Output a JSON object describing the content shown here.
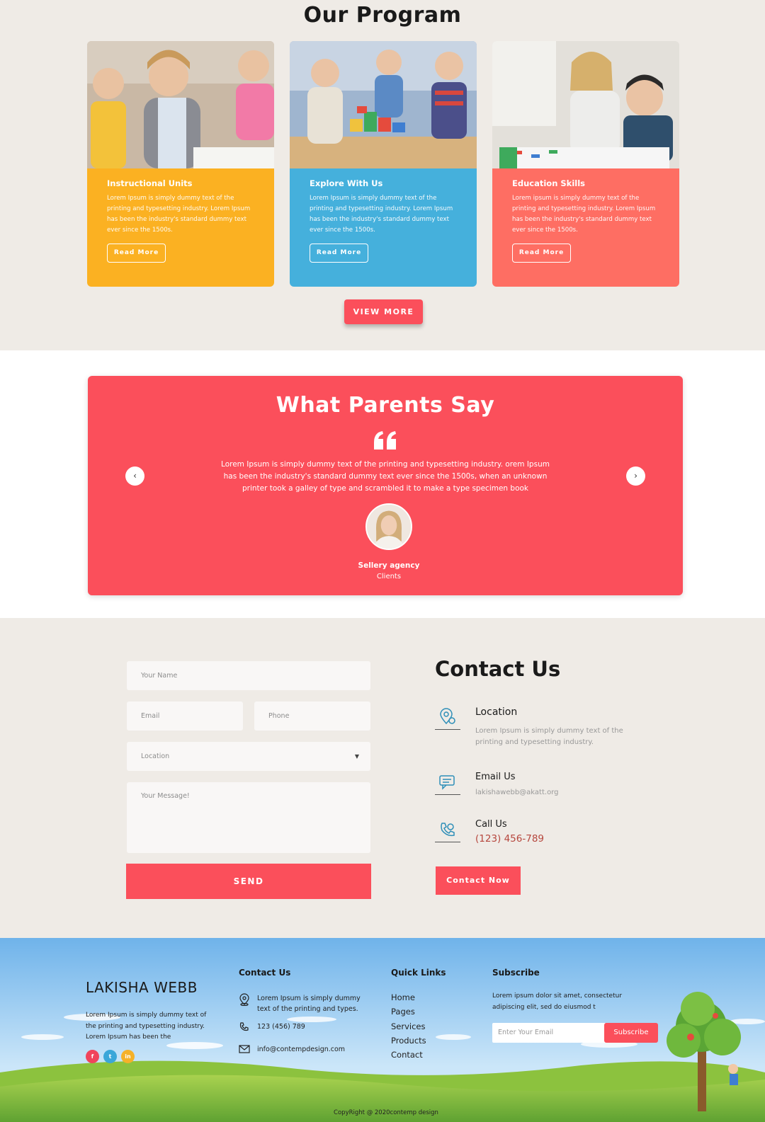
{
  "program": {
    "title": "Our Program",
    "cards": [
      {
        "title": "Instructional Units",
        "text": "Lorem Ipsum is simply dummy text of the printing and typesetting industry. Lorem Ipsum has been the industry's standard dummy text ever since the 1500s.",
        "button": "Read More",
        "color": "#fbb122"
      },
      {
        "title": "Explore With Us",
        "text": "Lorem Ipsum is simply dummy text of the printing and typesetting industry. Lorem Ipsum has been the industry's standard dummy text ever since the 1500s.",
        "button": "Read More",
        "color": "#45b0dc"
      },
      {
        "title": "Education Skills",
        "text": "Lorem ipsum is simply dummy text of the printing and typesetting industry. Lorem Ipsum has been the industry's standard dummy text ever since the 1500s.",
        "button": "Read More",
        "color": "#fe6e63"
      }
    ],
    "view_more": "VIEW MORE"
  },
  "testimonial": {
    "title": "What Parents Say",
    "quote": "Lorem Ipsum is simply dummy text of the printing and typesetting industry. orem Ipsum has been the industry's standard dummy text ever since the 1500s, when an unknown printer took a galley of type and scrambled it to make a type specimen book",
    "name": "Sellery agency",
    "role": "Clients",
    "prev_icon": "chevron-left-icon",
    "next_icon": "chevron-right-icon"
  },
  "form": {
    "name_placeholder": "Your Name",
    "email_placeholder": "Email",
    "phone_placeholder": "Phone",
    "location_placeholder": "Location",
    "message_placeholder": "Your Message!",
    "send": "SEND"
  },
  "contact": {
    "title": "Contact Us",
    "location_title": "Location",
    "location_text": "Lorem Ipsum is simply dummy text of the printing and typesetting industry.",
    "email_title": "Email Us",
    "email_text": "lakishawebb@akatt.org",
    "call_title": "Call Us",
    "call_text": "(123) 456-789",
    "button": "Contact Now"
  },
  "footer": {
    "brand": "LAKISHA WEBB",
    "about": "Lorem Ipsum is simply dummy text of the printing and typesetting industry. Lorem Ipsum has been the",
    "contact_title": "Contact Us",
    "contact_address": "Lorem Ipsum is simply dummy text of the printing and types.",
    "contact_phone": "123 (456) 789",
    "contact_email": "info@contempdesign.com",
    "links_title": "Quick Links",
    "links": [
      "Home",
      "Pages",
      "Services",
      "Products",
      "Contact"
    ],
    "subscribe_title": "Subscribe",
    "subscribe_text": "Lorem ipsum dolor sit amet, consectetur adipiscing elit, sed do eiusmod t",
    "subscribe_placeholder": "Enter Your Email",
    "subscribe_button": "Subscribe",
    "copyright": "CopyRight @ 2020contemp design",
    "social": {
      "facebook": "f",
      "twitter": "t",
      "linkedin": "in"
    }
  },
  "colors": {
    "accent": "#fb4f5b",
    "yellow": "#fbb122",
    "blue": "#45b0dc",
    "coral": "#fe6e63"
  }
}
